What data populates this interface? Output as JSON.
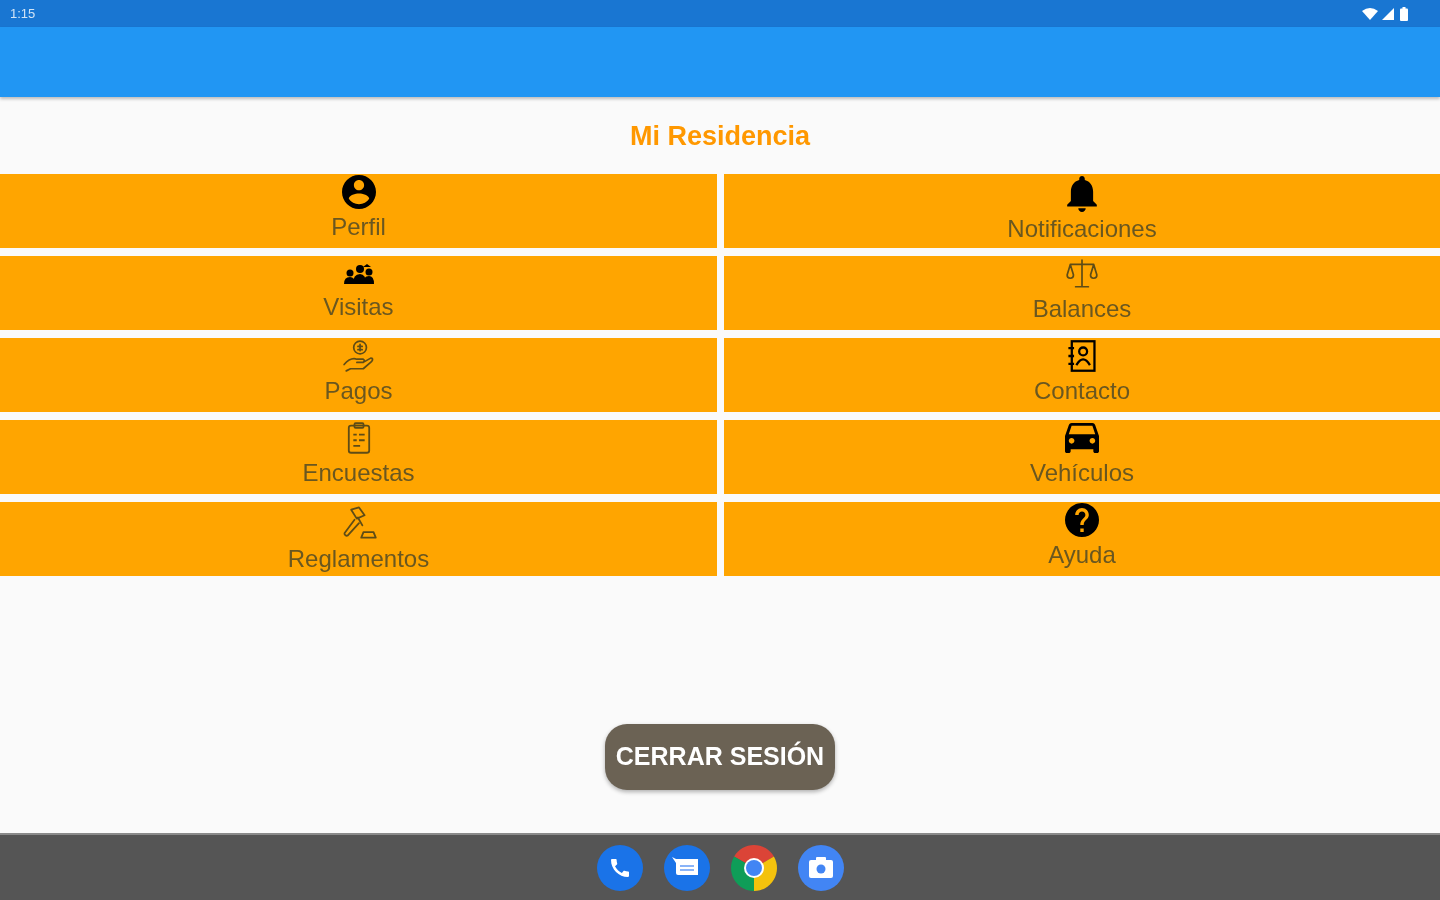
{
  "status_bar": {
    "time": "1:15"
  },
  "title": "Mi Residencia",
  "menu": [
    {
      "label": "Perfil"
    },
    {
      "label": "Notificaciones"
    },
    {
      "label": "Visitas"
    },
    {
      "label": "Balances"
    },
    {
      "label": "Pagos"
    },
    {
      "label": "Contacto"
    },
    {
      "label": "Encuestas"
    },
    {
      "label": "Vehículos"
    },
    {
      "label": "Reglamentos"
    },
    {
      "label": "Ayuda"
    }
  ],
  "logout_button": {
    "label": "CERRAR SESIÓN"
  }
}
